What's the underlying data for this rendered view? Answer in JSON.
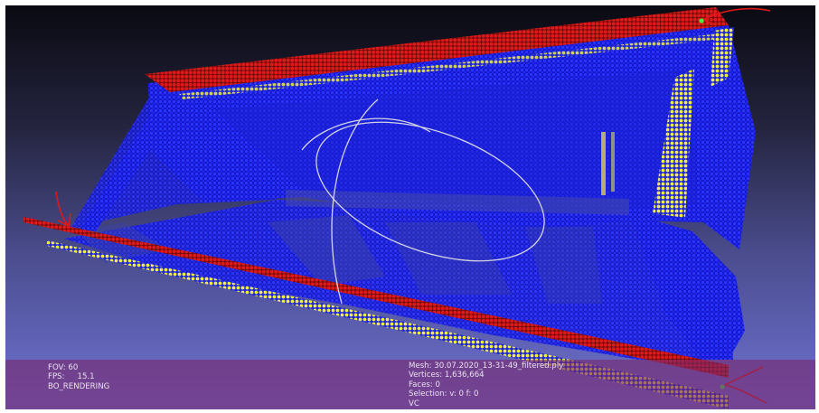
{
  "viewer": {
    "background_top": "#0a0a12",
    "background_bottom": "#6f73d4",
    "colors": {
      "point_blue": "#1a22ee",
      "point_red": "#d41414",
      "point_yellow": "#e4e040",
      "trackball": "#e6e6e6",
      "info_bar": "#78286e",
      "arrow": "#e01818"
    }
  },
  "info_left": {
    "fov": "FOV: 60",
    "fps_label": "FPS:",
    "fps_value": "15.1",
    "render_mode": "BO_RENDERING"
  },
  "info_center": {
    "mesh": "Mesh: 30.07.2020_13-31-49_filtered.ply",
    "vertices": "Vertices: 1,636,664",
    "faces": "Faces: 0",
    "selection": "Selection: v: 0 f: 0",
    "color_mode": "VC"
  }
}
